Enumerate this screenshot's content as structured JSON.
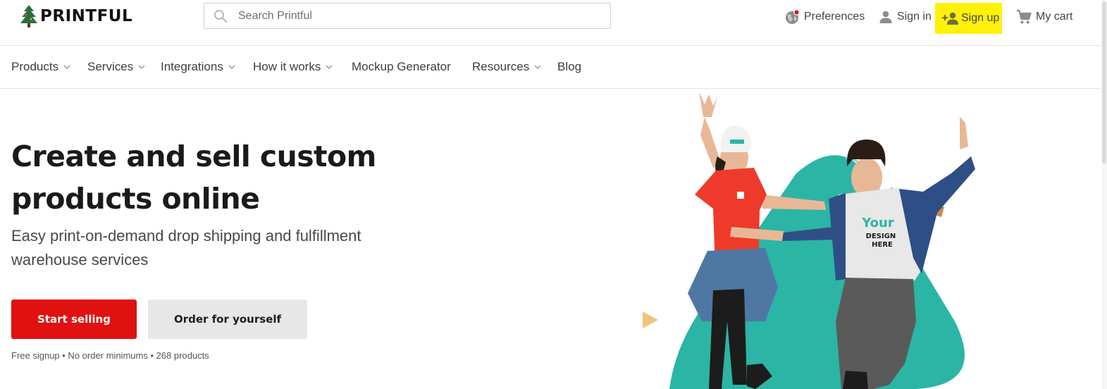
{
  "header": {
    "logo": {
      "text": "PRINTFUL",
      "icon": "pine-tree-icon"
    },
    "search": {
      "placeholder": "Search Printful",
      "value": ""
    },
    "links": {
      "preferences": "Preferences",
      "sign_in": "Sign in",
      "sign_up": "Sign up",
      "cart": "My cart"
    }
  },
  "nav": [
    {
      "label": "Products",
      "has_dropdown": true
    },
    {
      "label": "Services",
      "has_dropdown": true
    },
    {
      "label": "Integrations",
      "has_dropdown": true
    },
    {
      "label": "How it works",
      "has_dropdown": true
    },
    {
      "label": "Mockup Generator",
      "has_dropdown": false
    },
    {
      "label": "Resources",
      "has_dropdown": true
    },
    {
      "label": "Blog",
      "has_dropdown": false
    }
  ],
  "hero": {
    "title": "Create and sell custom products online",
    "subtitle": "Easy print-on-demand drop shipping and fulfillment warehouse services",
    "primary_cta": "Start selling",
    "secondary_cta": "Order for yourself",
    "note": "Free signup • No order minimums • 268 products",
    "image": {
      "shirt_print_line1": "Your",
      "shirt_print_line2": "DESIGN",
      "shirt_print_line3": "HERE"
    }
  },
  "colors": {
    "primary_red": "#e01111",
    "secondary_grey": "#e7e7e7",
    "highlight_yellow": "#fff10a",
    "accent_teal": "#2bb5a5",
    "accent_orange": "#f5c27c"
  }
}
